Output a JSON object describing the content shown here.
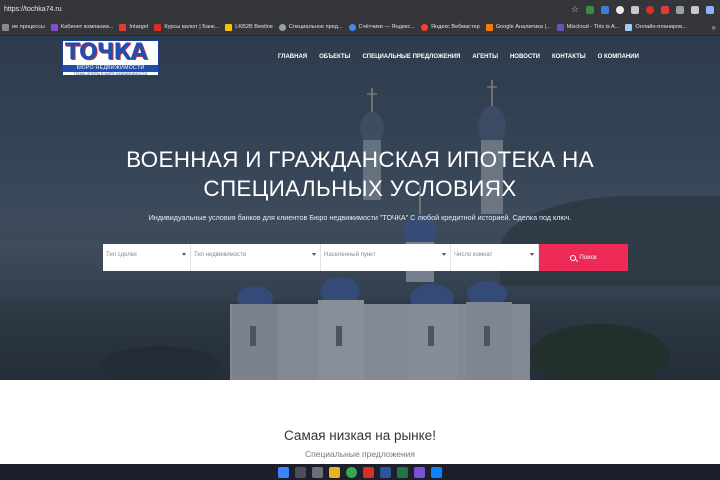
{
  "browser": {
    "url": "https://tochka74.ru",
    "bookmarks": [
      {
        "label": "ие процессы",
        "color": "#8a8a8a"
      },
      {
        "label": "Кабинет компании...",
        "color": "#7b4fd6"
      },
      {
        "label": "Intarget",
        "color": "#e53935"
      },
      {
        "label": "Курсы валют | Банк...",
        "color": "#d93025"
      },
      {
        "label": "LKB2B Beeline",
        "color": "#f2c500"
      },
      {
        "label": "Специальное пред...",
        "color": "#9aa0a6"
      },
      {
        "label": "Счётчики — Яндекс...",
        "color": "#4285f4"
      },
      {
        "label": "Яндекс Вебмастер",
        "color": "#ff3d2e"
      },
      {
        "label": "Google Аналитика |...",
        "color": "#f57c00"
      },
      {
        "label": "Miscloud - This is A...",
        "color": "#6b4fbb"
      },
      {
        "label": "Онлайн-планиров...",
        "color": "#9ecbf0"
      }
    ],
    "more_label": "»"
  },
  "logo": {
    "word": "ТОЧКА",
    "band": "БЮРО НЕДВИЖИМОСТИ",
    "sub": "ТОЧКА ОПОРЫ В МИРЕ НЕДВИЖИМОСТИ"
  },
  "nav": {
    "items": [
      "ГЛАВНАЯ",
      "ОБЪЕКТЫ",
      "СПЕЦИАЛЬНЫЕ ПРЕДЛОЖЕНИЯ",
      "АГЕНТЫ",
      "НОВОСТИ",
      "КОНТАКТЫ",
      "О КОМПАНИИ"
    ]
  },
  "hero": {
    "title_line1": "ВОЕННАЯ И ГРАЖДАНСКАЯ ИПОТЕКА НА",
    "title_line2": "СПЕЦИАЛЬНЫХ УСЛОВИЯХ",
    "subtitle": "Индивидуальные условия банков для клиентов Бюро недвижимости \"ТОЧКА\" С любой кредитной историей. Сделка под ключ."
  },
  "search": {
    "deal_type": "Тип сделки",
    "property_type": "Тип недвижимости",
    "locality": "Населенный пункт",
    "rooms": "Число комнат",
    "button": "Поиск"
  },
  "section": {
    "title": "Самая низкая на рынке!",
    "subtitle": "Специальные предложения"
  },
  "colors": {
    "accent": "#ee2b56",
    "logo_blue": "#1e4fb0",
    "chrome": "#35363a"
  }
}
